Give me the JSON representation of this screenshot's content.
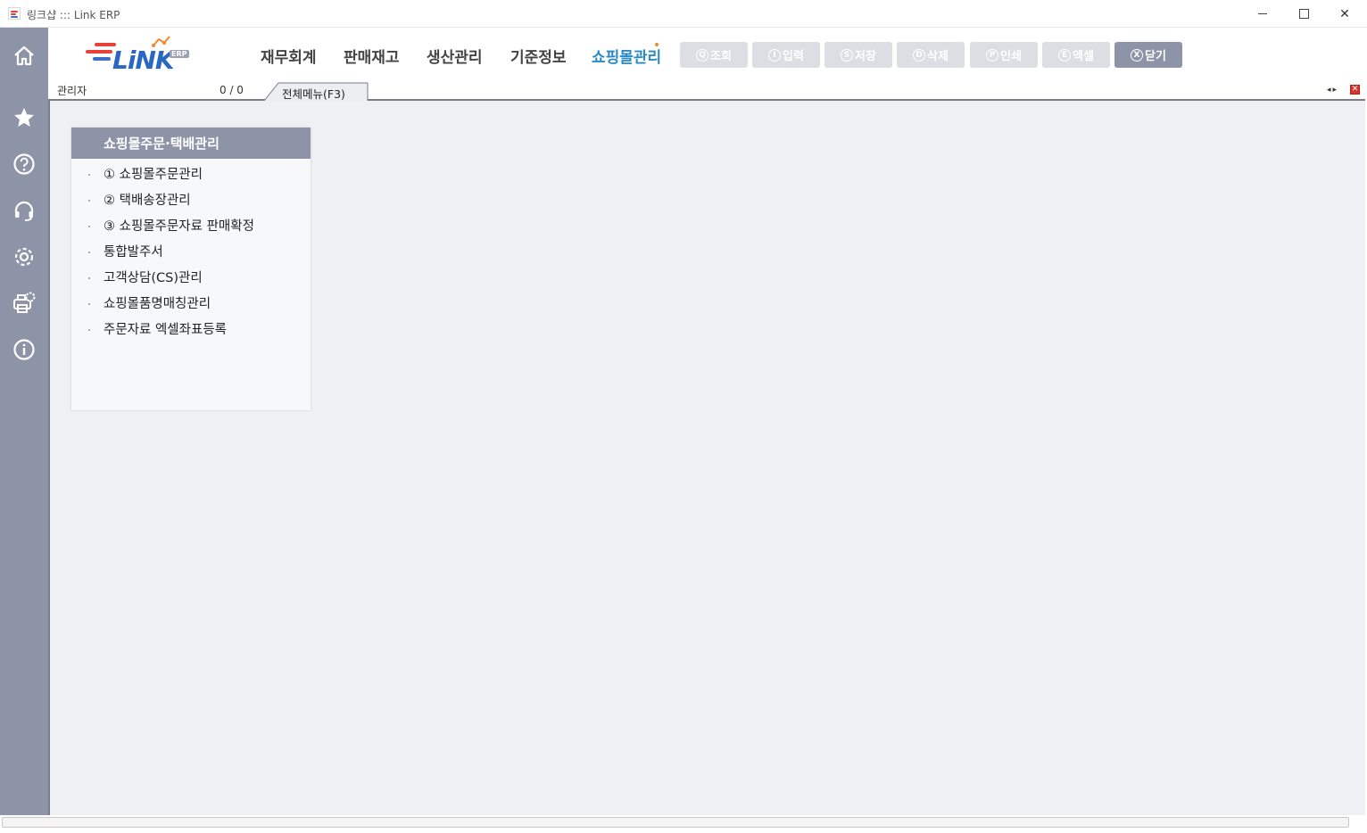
{
  "window": {
    "title": "링크샵 ::: Link ERP",
    "minimize_label": "",
    "close_glyph": "✕"
  },
  "colors": {
    "sidebar": "#8e94a8",
    "active_menu": "#2a8ac4",
    "toolbar_disabled": "#dcdee3",
    "workspace": "#eff0f3",
    "accent_dot": "#f08a2c"
  },
  "sidebar": {
    "icons": [
      "home-icon",
      "star-icon",
      "help-icon",
      "headset-icon",
      "gear-icon",
      "printer-settings-icon",
      "info-icon"
    ]
  },
  "logo": {
    "text": "LiNK",
    "badge": "ERP"
  },
  "menu": {
    "items": [
      {
        "label": "재무회계",
        "active": false
      },
      {
        "label": "판매재고",
        "active": false
      },
      {
        "label": "생산관리",
        "active": false
      },
      {
        "label": "기준정보",
        "active": false
      },
      {
        "label": "쇼핑몰관리",
        "active": true
      }
    ]
  },
  "toolbar": {
    "buttons": [
      {
        "key": "Q",
        "label": "조회",
        "enabled": false
      },
      {
        "key": "I",
        "label": "입력",
        "enabled": false
      },
      {
        "key": "S",
        "label": "저장",
        "enabled": false
      },
      {
        "key": "D",
        "label": "삭제",
        "enabled": false
      },
      {
        "key": "P",
        "label": "인쇄",
        "enabled": false
      },
      {
        "key": "E",
        "label": "엑셀",
        "enabled": false
      },
      {
        "key": "X",
        "label": "닫기",
        "enabled": true
      }
    ]
  },
  "tabstrip": {
    "user": "관리자",
    "count": "0 / 0",
    "tab_label": "전체메뉴(F3)",
    "nav_arrows": "◂▸",
    "close_glyph": "✕"
  },
  "panel": {
    "title": "쇼핑몰주문·택배관리",
    "items": [
      "① 쇼핑몰주문관리",
      "② 택배송장관리",
      "③ 쇼핑몰주문자료 판매확정",
      "통합발주서",
      "고객상담(CS)관리",
      "쇼핑몰품명매칭관리",
      "주문자료 엑셀좌표등록"
    ]
  }
}
